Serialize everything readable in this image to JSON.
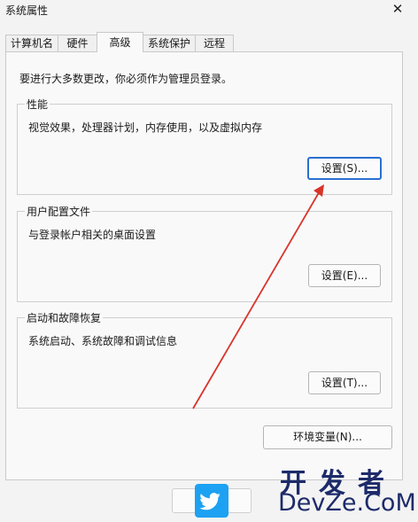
{
  "window": {
    "title": "系统属性",
    "close_glyph": "✕"
  },
  "tabs": [
    {
      "label": "计算机名"
    },
    {
      "label": "硬件"
    },
    {
      "label": "高级"
    },
    {
      "label": "系统保护"
    },
    {
      "label": "远程"
    }
  ],
  "active_tab": "高级",
  "notice": "要进行大多数更改，你必须作为管理员登录。",
  "performance": {
    "title": "性能",
    "description": "视觉效果，处理器计划，内存使用，以及虚拟内存",
    "button": "设置(S)..."
  },
  "user_profiles": {
    "title": "用户配置文件",
    "description": "与登录帐户相关的桌面设置",
    "button": "设置(E)..."
  },
  "startup_recovery": {
    "title": "启动和故障恢复",
    "description": "系统启动、系统故障和调试信息",
    "button": "设置(T)..."
  },
  "env_button": "环境变量(N)...",
  "annotation": {
    "color": "#d9342b",
    "points_to": "performance-settings-button"
  },
  "watermark": {
    "top_text": "开发者",
    "bottom_text": "DevZe.CoM",
    "icon": "twitter-bird-icon",
    "color": "#1d2b6a",
    "icon_color": "#1da1f2"
  }
}
